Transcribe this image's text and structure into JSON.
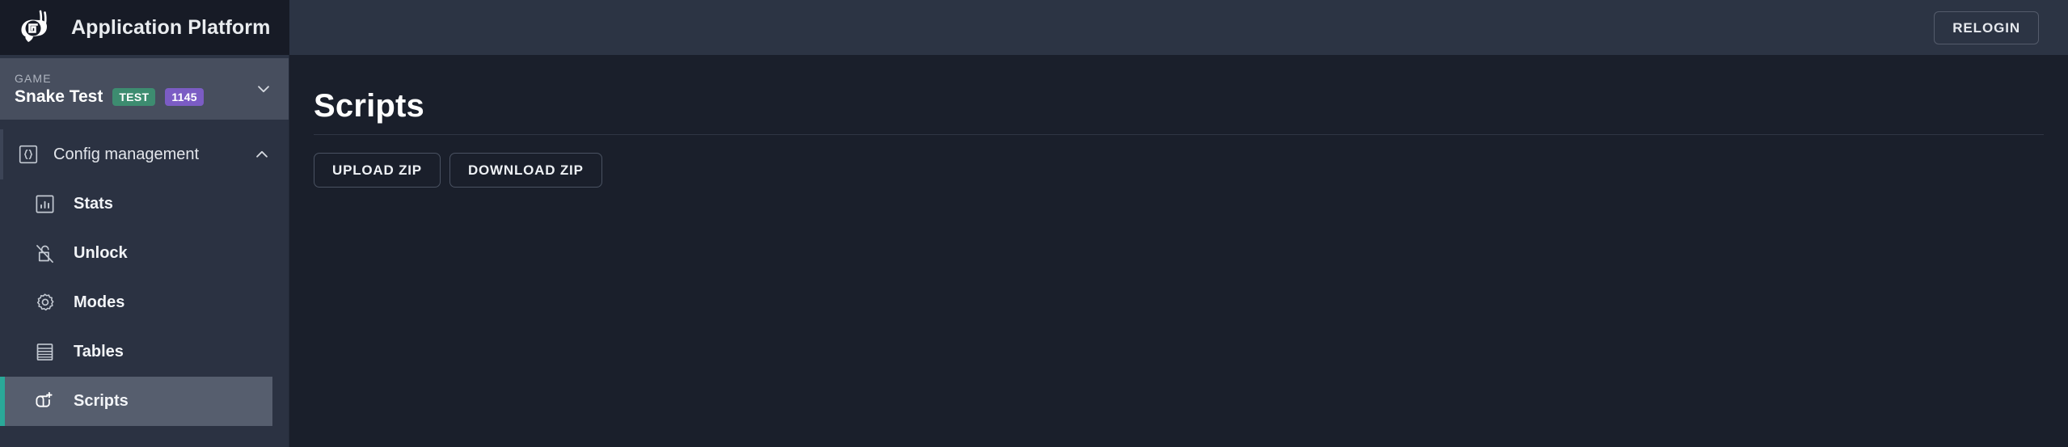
{
  "topbar": {
    "brand_title": "Application Platform",
    "logo_icon": "snail-logo-icon",
    "relogin_label": "RELOGIN"
  },
  "sidebar": {
    "game_selector": {
      "label": "GAME",
      "name": "Snake Test",
      "env_badge": "TEST",
      "id_badge": "1145",
      "chevron_icon": "chevron-down-icon"
    },
    "groups": [
      {
        "label": "Config management",
        "icon": "braces-icon",
        "expanded": true,
        "chevron_icon": "chevron-up-icon",
        "items": [
          {
            "label": "Stats",
            "icon": "bar-chart-box-icon",
            "active": false
          },
          {
            "label": "Unlock",
            "icon": "unlock-slash-icon",
            "active": false
          },
          {
            "label": "Modes",
            "icon": "gear-icon",
            "active": false
          },
          {
            "label": "Tables",
            "icon": "table-rows-icon",
            "active": false
          },
          {
            "label": "Scripts",
            "icon": "script-add-icon",
            "active": true
          }
        ]
      }
    ]
  },
  "main": {
    "page_title": "Scripts",
    "toolbar": {
      "upload_label": "UPLOAD ZIP",
      "download_label": "DOWNLOAD ZIP"
    }
  },
  "colors": {
    "accent_teal": "#2aa898",
    "badge_env_green": "#3d8c70",
    "badge_id_purple": "#7b5cc4",
    "topbar_bg": "#2c3444",
    "brand_bg": "#171b26",
    "sidebar_bg": "#2b3242",
    "game_selector_bg": "#474e5e",
    "nav_active_bg": "#565e6e",
    "main_bg": "#1a1f2b"
  }
}
